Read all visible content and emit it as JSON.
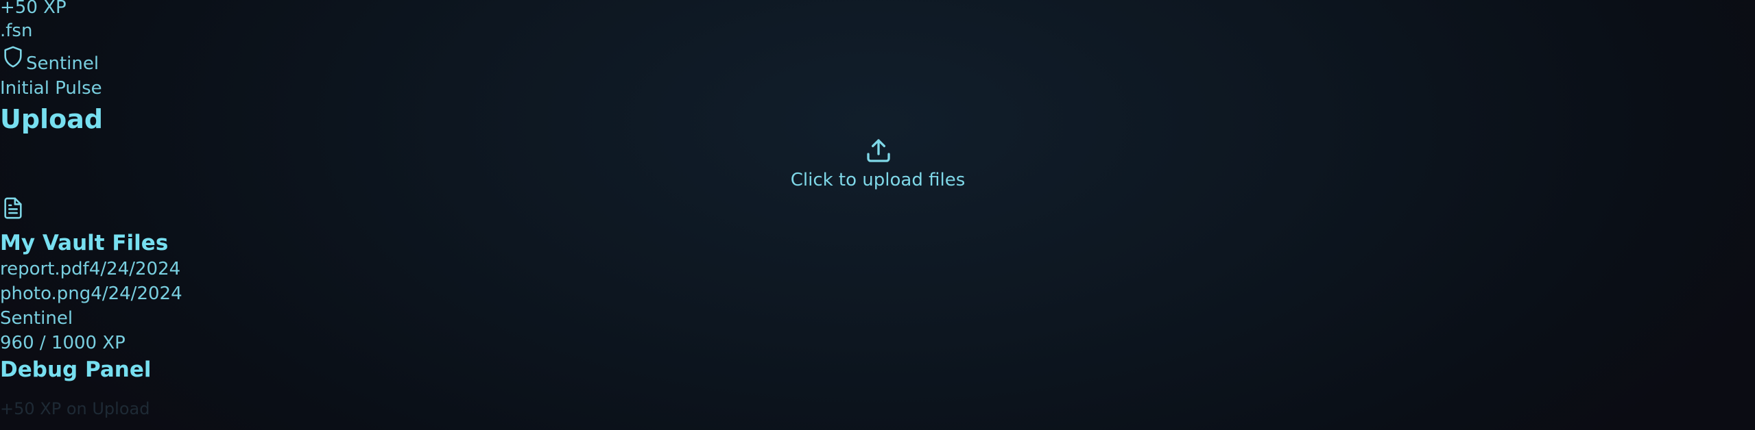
{
  "reward": {
    "xp_gain": "+50 XP",
    "extension": ".fsn"
  },
  "rank": {
    "name": "Sentinel",
    "icon": "shield-icon"
  },
  "pulse": {
    "label": "Initial Pulse"
  },
  "upload": {
    "heading": "Upload",
    "dropzone_label": "Click to upload files",
    "icon": "upload-icon"
  },
  "vault": {
    "icon": "file-text-icon",
    "heading": "My Vault Files",
    "files": [
      {
        "name": "report.pdf",
        "date": "4/24/2024"
      },
      {
        "name": "photo.png",
        "date": "4/24/2024"
      }
    ]
  },
  "level": {
    "rank_name": "Sentinel",
    "xp": "960 / 1000 XP",
    "xp_fraction": 0.96
  },
  "debug": {
    "heading": "Debug Panel",
    "action_label": "+50 XP on Upload"
  },
  "colors": {
    "accent": "#7fd8e8",
    "background": "#0b1119"
  }
}
